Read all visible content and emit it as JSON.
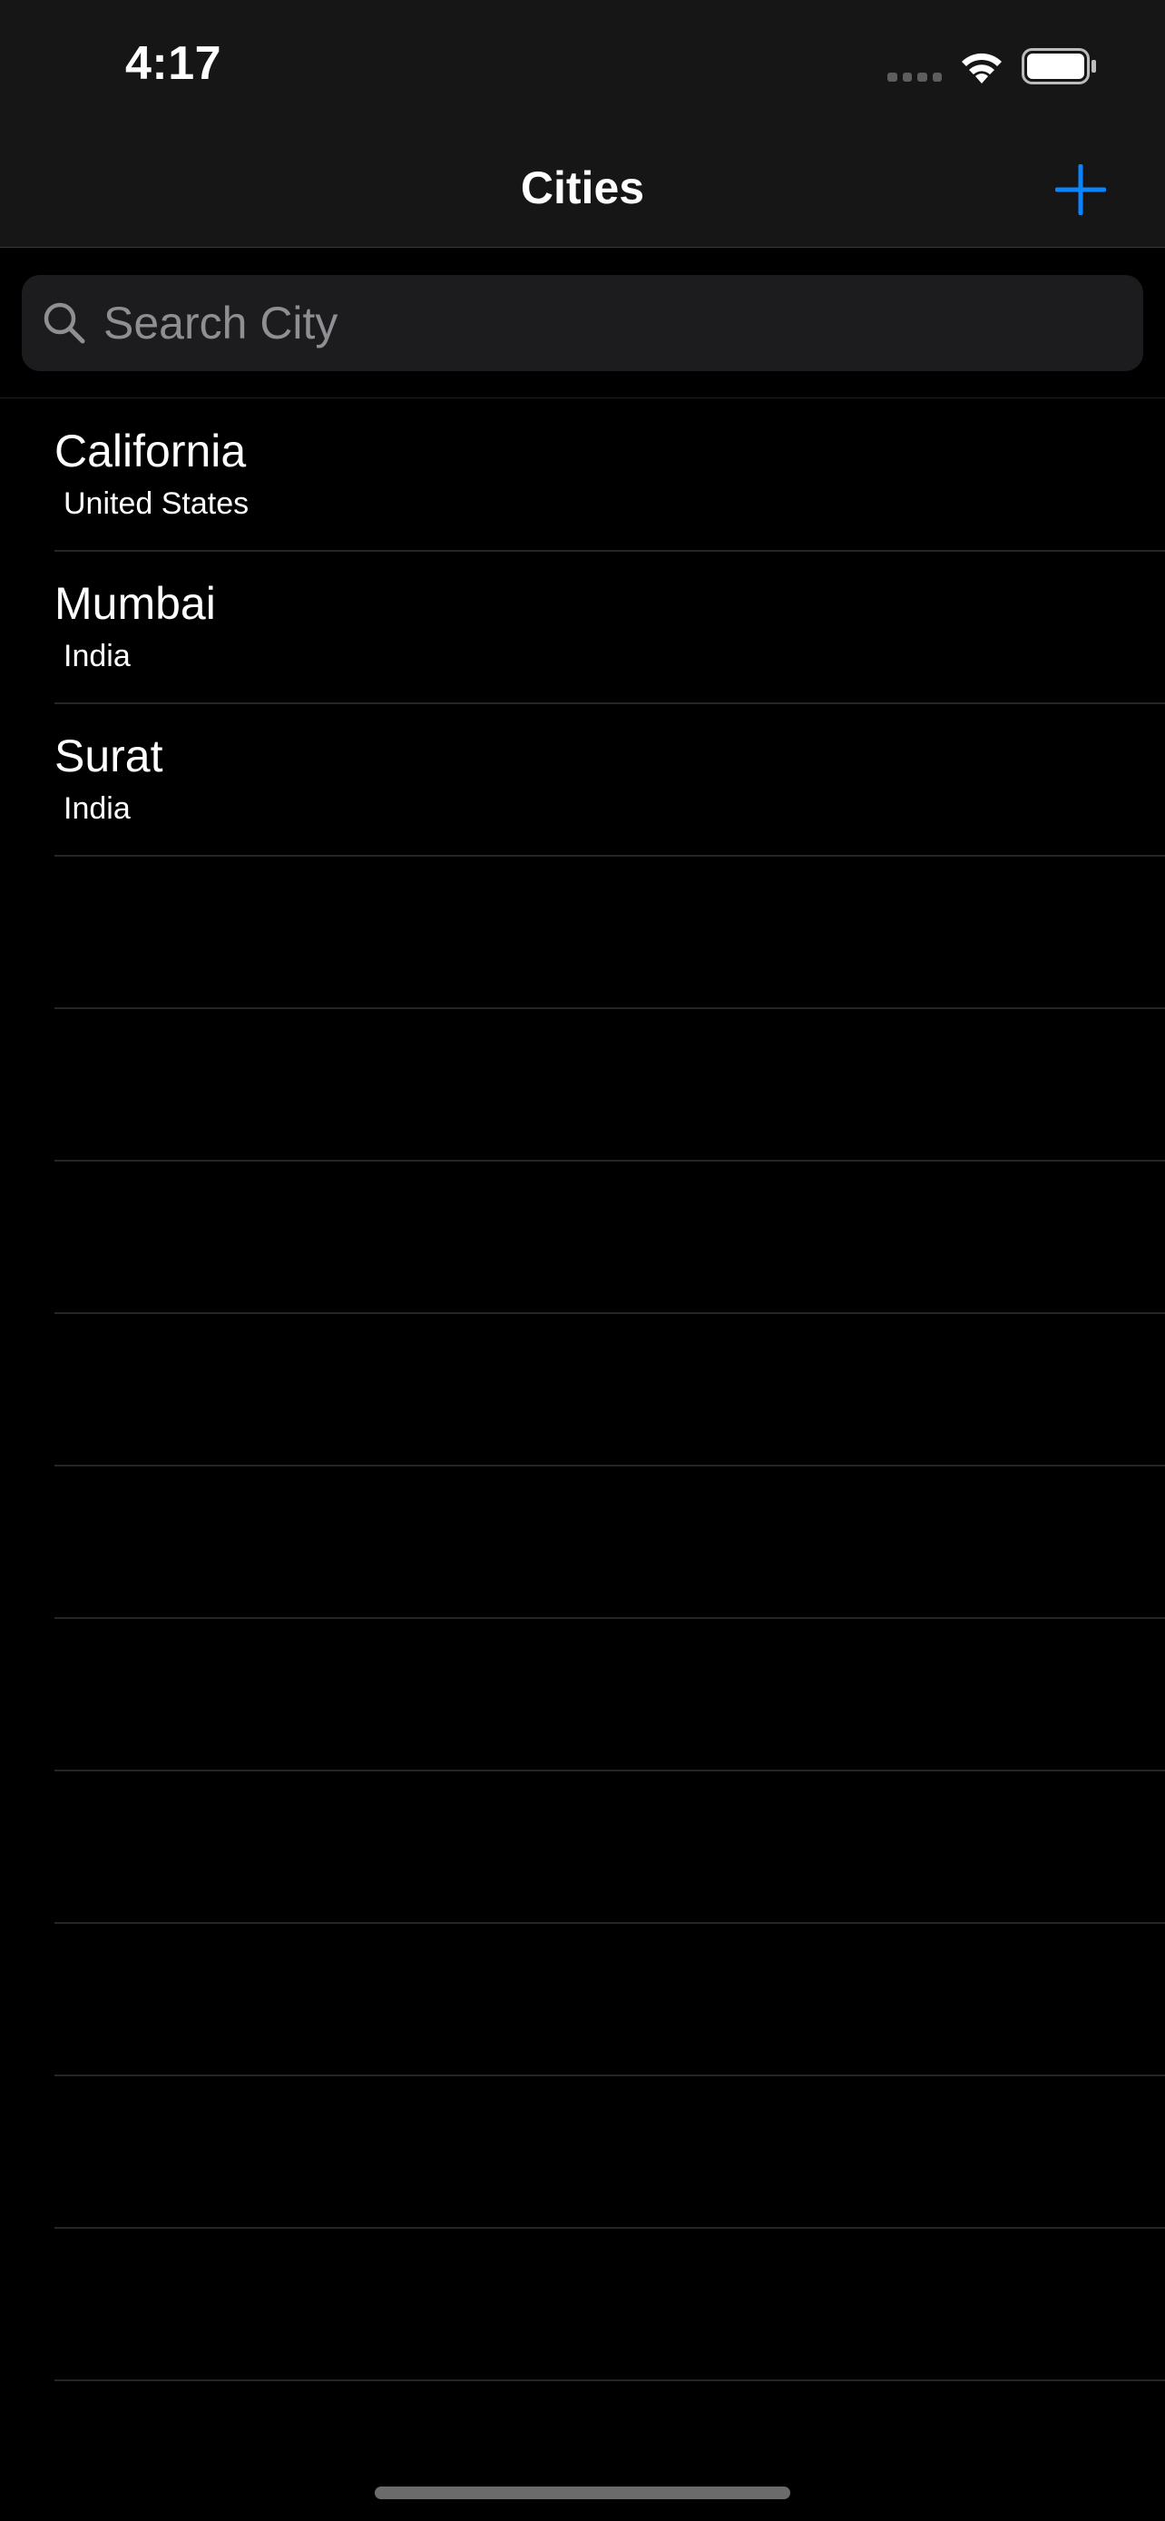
{
  "status_bar": {
    "time": "4:17",
    "icons": [
      "signal-icon",
      "wifi-icon",
      "battery-icon"
    ]
  },
  "nav": {
    "title": "Cities",
    "add_icon": "plus-icon"
  },
  "search": {
    "placeholder": "Search City",
    "icon": "magnifier-icon"
  },
  "cities": [
    {
      "name": "California",
      "country": "United States"
    },
    {
      "name": "Mumbai",
      "country": "India"
    },
    {
      "name": "Surat",
      "country": "India"
    }
  ],
  "empty_row_count": 10,
  "colors": {
    "accent": "#0a84ff",
    "background": "#000000",
    "nav_background": "#161616",
    "search_field": "#1c1c1e",
    "placeholder": "#8e8e93",
    "separator": "#262626"
  }
}
